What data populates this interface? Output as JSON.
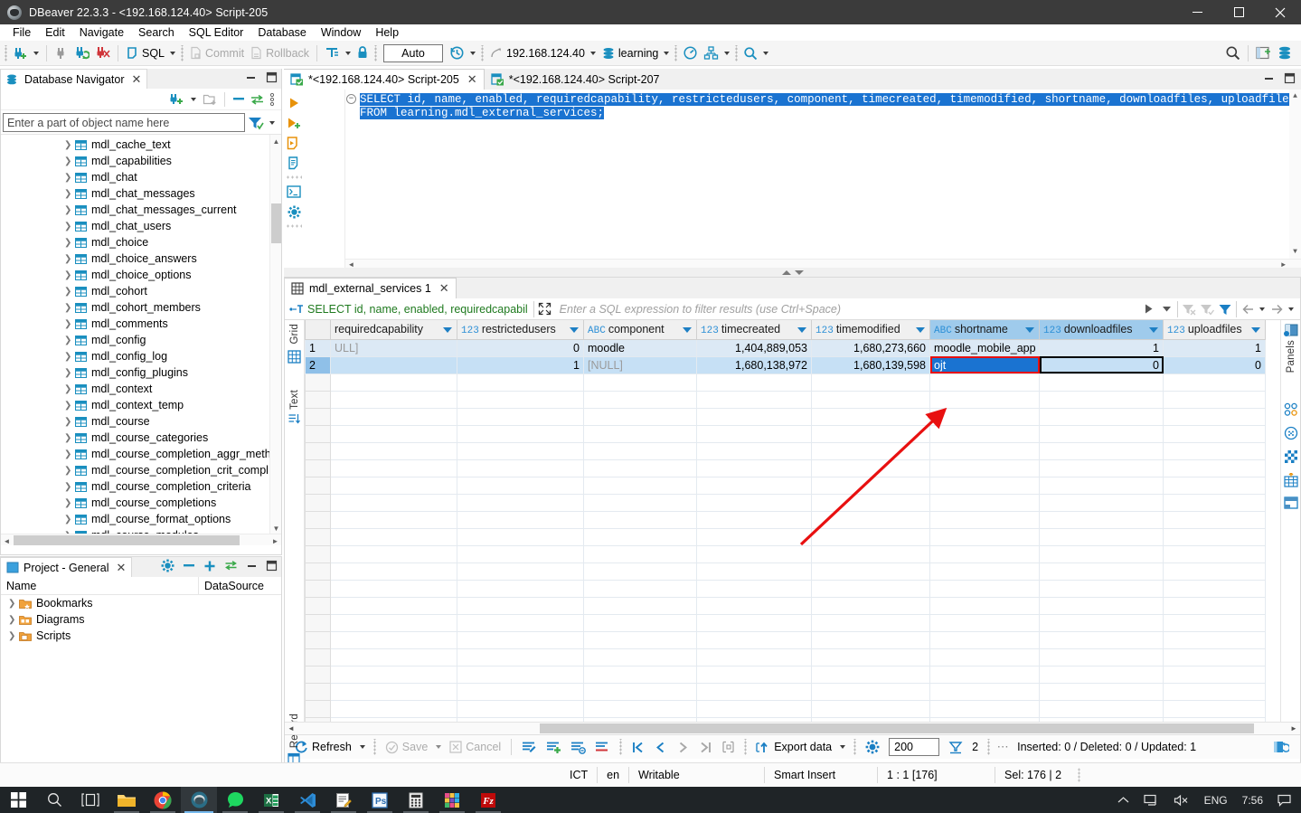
{
  "window": {
    "title": "DBeaver 22.3.3 - <192.168.124.40> Script-205",
    "minimize": "minimize",
    "maximize": "maximize",
    "close": "close"
  },
  "menu": [
    "File",
    "Edit",
    "Navigate",
    "Search",
    "SQL Editor",
    "Database",
    "Window",
    "Help"
  ],
  "toolbar": {
    "new_connection": "new-connection",
    "disconnect": "disconnect",
    "refresh_connection": "refresh-connection",
    "reject_connection": "reject-connection",
    "sql_label": "SQL",
    "commit_label": "Commit",
    "rollback_label": "Rollback",
    "transaction_mode": "transaction-mode",
    "lock_icon": "lock",
    "auto_label": "Auto",
    "history_icon": "history",
    "datasource_value": "192.168.124.40",
    "database_value": "learning",
    "dashboard_icon": "dashboard",
    "schema_icon": "schema-compare",
    "search_icon": "search",
    "right_search_icon": "global-search",
    "right_perspective_icon": "open-perspective",
    "right_db_icon": "database-perspective"
  },
  "navigator": {
    "tab_label": "Database Navigator",
    "search_placeholder": "Enter a part of object name here",
    "items": [
      "mdl_cache_text",
      "mdl_capabilities",
      "mdl_chat",
      "mdl_chat_messages",
      "mdl_chat_messages_current",
      "mdl_chat_users",
      "mdl_choice",
      "mdl_choice_answers",
      "mdl_choice_options",
      "mdl_cohort",
      "mdl_cohort_members",
      "mdl_comments",
      "mdl_config",
      "mdl_config_log",
      "mdl_config_plugins",
      "mdl_context",
      "mdl_context_temp",
      "mdl_course",
      "mdl_course_categories",
      "mdl_course_completion_aggr_meth",
      "mdl_course_completion_crit_compl",
      "mdl_course_completion_criteria",
      "mdl_course_completions",
      "mdl_course_format_options",
      "mdl_course_modules"
    ]
  },
  "project": {
    "tab_label": "Project - General",
    "columns": [
      "Name",
      "DataSource"
    ],
    "items": [
      "Bookmarks",
      "Diagrams",
      "Scripts"
    ]
  },
  "editor": {
    "tabs": [
      {
        "label": "*<192.168.124.40> Script-205",
        "active": true
      },
      {
        "label": "*<192.168.124.40> Script-207",
        "active": false
      }
    ],
    "code_line_1": "SELECT id, name, enabled, requiredcapability, restrictedusers, component, timecreated, timemodified, shortname, downloadfiles, uploadfiles",
    "code_line_2": "FROM learning.mdl_external_services;"
  },
  "results": {
    "tab_label": "mdl_external_services 1",
    "filter_prefix": "SELECT id, name, enabled, requiredcapabil",
    "filter_placeholder": "Enter a SQL expression to filter results (use Ctrl+Space)",
    "grid_vtabs": [
      "Grid",
      "Text",
      "Record"
    ],
    "panels_label": "Panels",
    "columns": [
      {
        "name": "requiredcapability",
        "type": "",
        "selected": false
      },
      {
        "name": "restrictedusers",
        "type": "123",
        "selected": false
      },
      {
        "name": "component",
        "type": "ABC",
        "selected": false
      },
      {
        "name": "timecreated",
        "type": "123",
        "selected": false
      },
      {
        "name": "timemodified",
        "type": "123",
        "selected": false
      },
      {
        "name": "shortname",
        "type": "ABC",
        "selected": true
      },
      {
        "name": "downloadfiles",
        "type": "123",
        "selected": false
      },
      {
        "name": "uploadfiles",
        "type": "123",
        "selected": false
      }
    ],
    "rows": [
      {
        "num": "1",
        "requiredcapability": "ULL]",
        "restrictedusers": "0",
        "component": "moodle",
        "timecreated": "1,404,889,053",
        "timemodified": "1,680,273,660",
        "shortname": "moodle_mobile_app",
        "downloadfiles": "1",
        "uploadfiles": "1"
      },
      {
        "num": "2",
        "requiredcapability": "",
        "restrictedusers": "1",
        "component": "[NULL]",
        "timecreated": "1,680,138,972",
        "timemodified": "1,680,139,598",
        "shortname": "ojt",
        "downloadfiles": "0",
        "uploadfiles": "0"
      }
    ],
    "toolbar": {
      "refresh": "Refresh",
      "save": "Save",
      "cancel": "Cancel",
      "edit_icon": "edit-row",
      "add_icon": "add-row",
      "duplicate_icon": "duplicate-row",
      "delete_icon": "delete-row",
      "first_icon": "first-page",
      "prev_icon": "previous-page",
      "next_icon": "next-page",
      "last_icon": "last-page",
      "calc_icon": "calculate-row-count",
      "export": "Export data",
      "config_icon": "result-settings",
      "fetch_size": "200",
      "fetch_icon": "fetch-next-page",
      "row_count": "2",
      "status": "Inserted: 0 / Deleted: 0 / Updated: 1",
      "restore_icon": "restore-panel"
    }
  },
  "statusbar": {
    "encoding": "ICT",
    "lang": "en",
    "writable": "Writable",
    "insert_mode": "Smart Insert",
    "position": "1 : 1 [176]",
    "selection": "Sel: 176 | 2"
  },
  "taskbar": {
    "start": "start-icon",
    "search": "search-icon",
    "taskview": "task-view-icon",
    "apps": [
      "file-explorer-icon",
      "chrome-icon",
      "dbeaver-icon",
      "messenger-icon",
      "excel-icon",
      "vscode-icon",
      "notepad-icon",
      "photoshop-icon",
      "calculator-icon",
      "apps-grid-icon",
      "filezilla-icon"
    ],
    "tray": {
      "chevron": "show-hidden-icons",
      "network": "network-icon",
      "volume": "volume-muted-icon",
      "language": "ENG",
      "time": "7:56",
      "notifications": "notification-icon"
    }
  },
  "colors": {
    "accent": "#1a73d1",
    "annotation": "#e81010",
    "titlebar": "#3b3b3b",
    "selected_header": "#9fcbec"
  }
}
